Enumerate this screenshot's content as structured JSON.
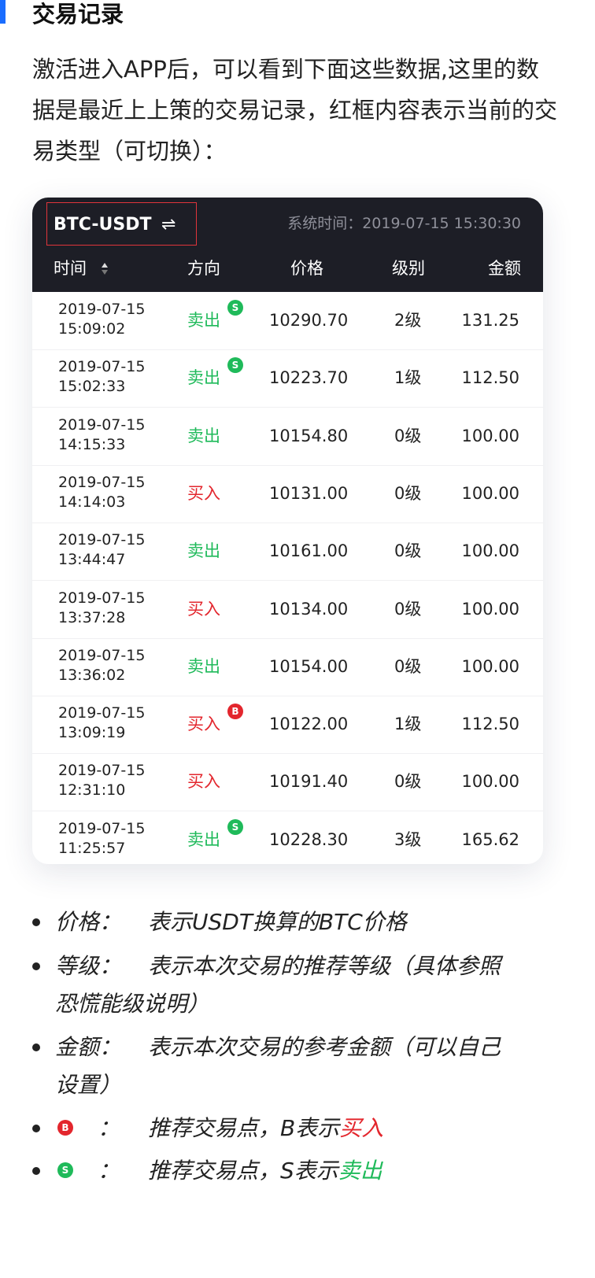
{
  "page": {
    "title": "交易记录",
    "intro": "激活进入APP后，可以看到下面这些数据,这里的数据是最近上上策的交易记录，红框内容表示当前的交易类型（可切换）："
  },
  "card": {
    "pair": "BTC-USDT",
    "swap_icon": "⇌",
    "system_time": "系统时间：2019-07-15 15:30:30",
    "columns": [
      "时间",
      "方向",
      "价格",
      "级别",
      "金额"
    ],
    "rows": [
      {
        "date": "2019-07-15",
        "time": "15:09:02",
        "dir": "卖出",
        "side": "sell",
        "badge": "S",
        "price": "10290.70",
        "level": "2级",
        "amount": "131.25"
      },
      {
        "date": "2019-07-15",
        "time": "15:02:33",
        "dir": "卖出",
        "side": "sell",
        "badge": "S",
        "price": "10223.70",
        "level": "1级",
        "amount": "112.50"
      },
      {
        "date": "2019-07-15",
        "time": "14:15:33",
        "dir": "卖出",
        "side": "sell",
        "badge": "",
        "price": "10154.80",
        "level": "0级",
        "amount": "100.00"
      },
      {
        "date": "2019-07-15",
        "time": "14:14:03",
        "dir": "买入",
        "side": "buy",
        "badge": "",
        "price": "10131.00",
        "level": "0级",
        "amount": "100.00"
      },
      {
        "date": "2019-07-15",
        "time": "13:44:47",
        "dir": "卖出",
        "side": "sell",
        "badge": "",
        "price": "10161.00",
        "level": "0级",
        "amount": "100.00"
      },
      {
        "date": "2019-07-15",
        "time": "13:37:28",
        "dir": "买入",
        "side": "buy",
        "badge": "",
        "price": "10134.00",
        "level": "0级",
        "amount": "100.00"
      },
      {
        "date": "2019-07-15",
        "time": "13:36:02",
        "dir": "卖出",
        "side": "sell",
        "badge": "",
        "price": "10154.00",
        "level": "0级",
        "amount": "100.00"
      },
      {
        "date": "2019-07-15",
        "time": "13:09:19",
        "dir": "买入",
        "side": "buy",
        "badge": "B",
        "price": "10122.00",
        "level": "1级",
        "amount": "112.50"
      },
      {
        "date": "2019-07-15",
        "time": "12:31:10",
        "dir": "买入",
        "side": "buy",
        "badge": "",
        "price": "10191.40",
        "level": "0级",
        "amount": "100.00"
      },
      {
        "date": "2019-07-15",
        "time": "11:25:57",
        "dir": "卖出",
        "side": "sell",
        "badge": "S",
        "price": "10228.30",
        "level": "3级",
        "amount": "165.62"
      }
    ]
  },
  "notes": {
    "price": {
      "term": "价格：",
      "desc": "表示USDT换算的BTC价格"
    },
    "level": {
      "term": "等级：",
      "desc": "表示本次交易的推荐等级（具体参照",
      "cont": "恐慌能级说明）"
    },
    "amount": {
      "term": "金额：",
      "desc": "表示本次交易的参考金额（可以自己",
      "cont": "设置）"
    },
    "b": {
      "badge": "B",
      "colon": "：",
      "desc": "推荐交易点，B表示",
      "highlight": "买入"
    },
    "s": {
      "badge": "S",
      "colon": "：",
      "desc": "推荐交易点，S表示",
      "highlight": "卖出"
    }
  },
  "colors": {
    "accent": "#1a6dff",
    "buy": "#e3262d",
    "sell": "#1fba5a",
    "header_bg": "#1d1e26",
    "highlight_box": "#e0353b"
  }
}
